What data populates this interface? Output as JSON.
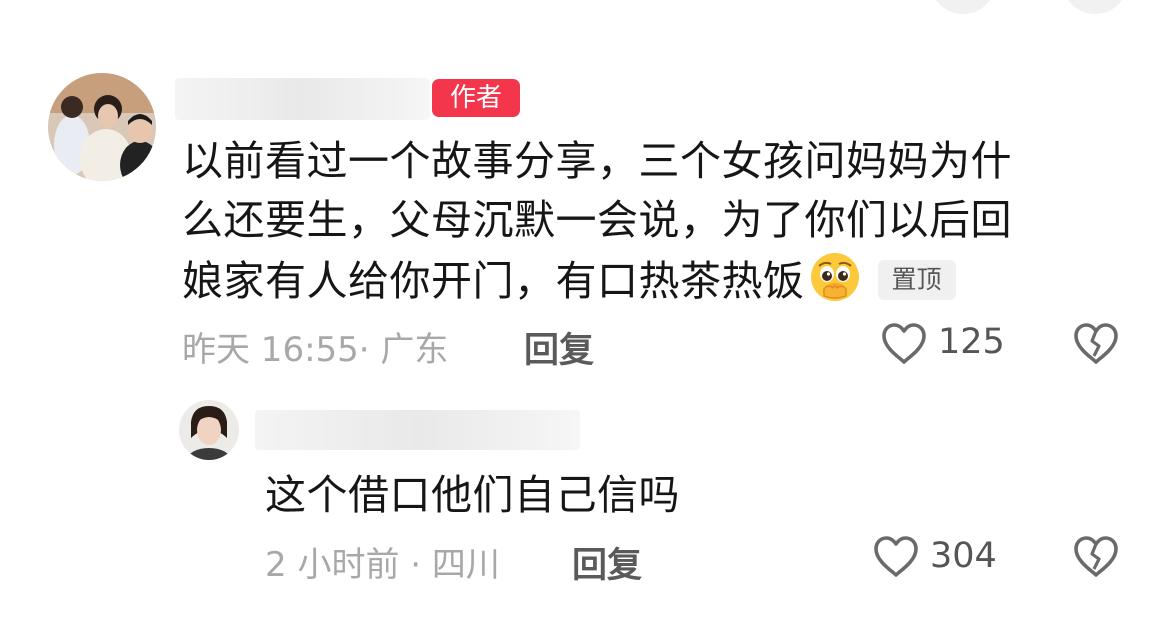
{
  "comment": {
    "author_badge": "作者",
    "text_lines": [
      "以前看过一个故事分享，三个女孩问妈妈为什",
      "么还要生，父母沉默一会说，为了你们以后回",
      "娘家有人给你开门，有口热茶热饭"
    ],
    "emoji": "pleading-face-icon",
    "pinned_label": "置顶",
    "time_location": "昨天 16:55· 广东",
    "reply_label": "回复",
    "like_count": "125"
  },
  "reply": {
    "text": "这个借口他们自己信吗",
    "time_location": "2 小时前 · 四川",
    "reply_label": "回复",
    "like_count": "304"
  },
  "colors": {
    "author_badge": "#f4364c",
    "meta_text": "#a8a8a8",
    "icon": "#6a6a6a"
  }
}
